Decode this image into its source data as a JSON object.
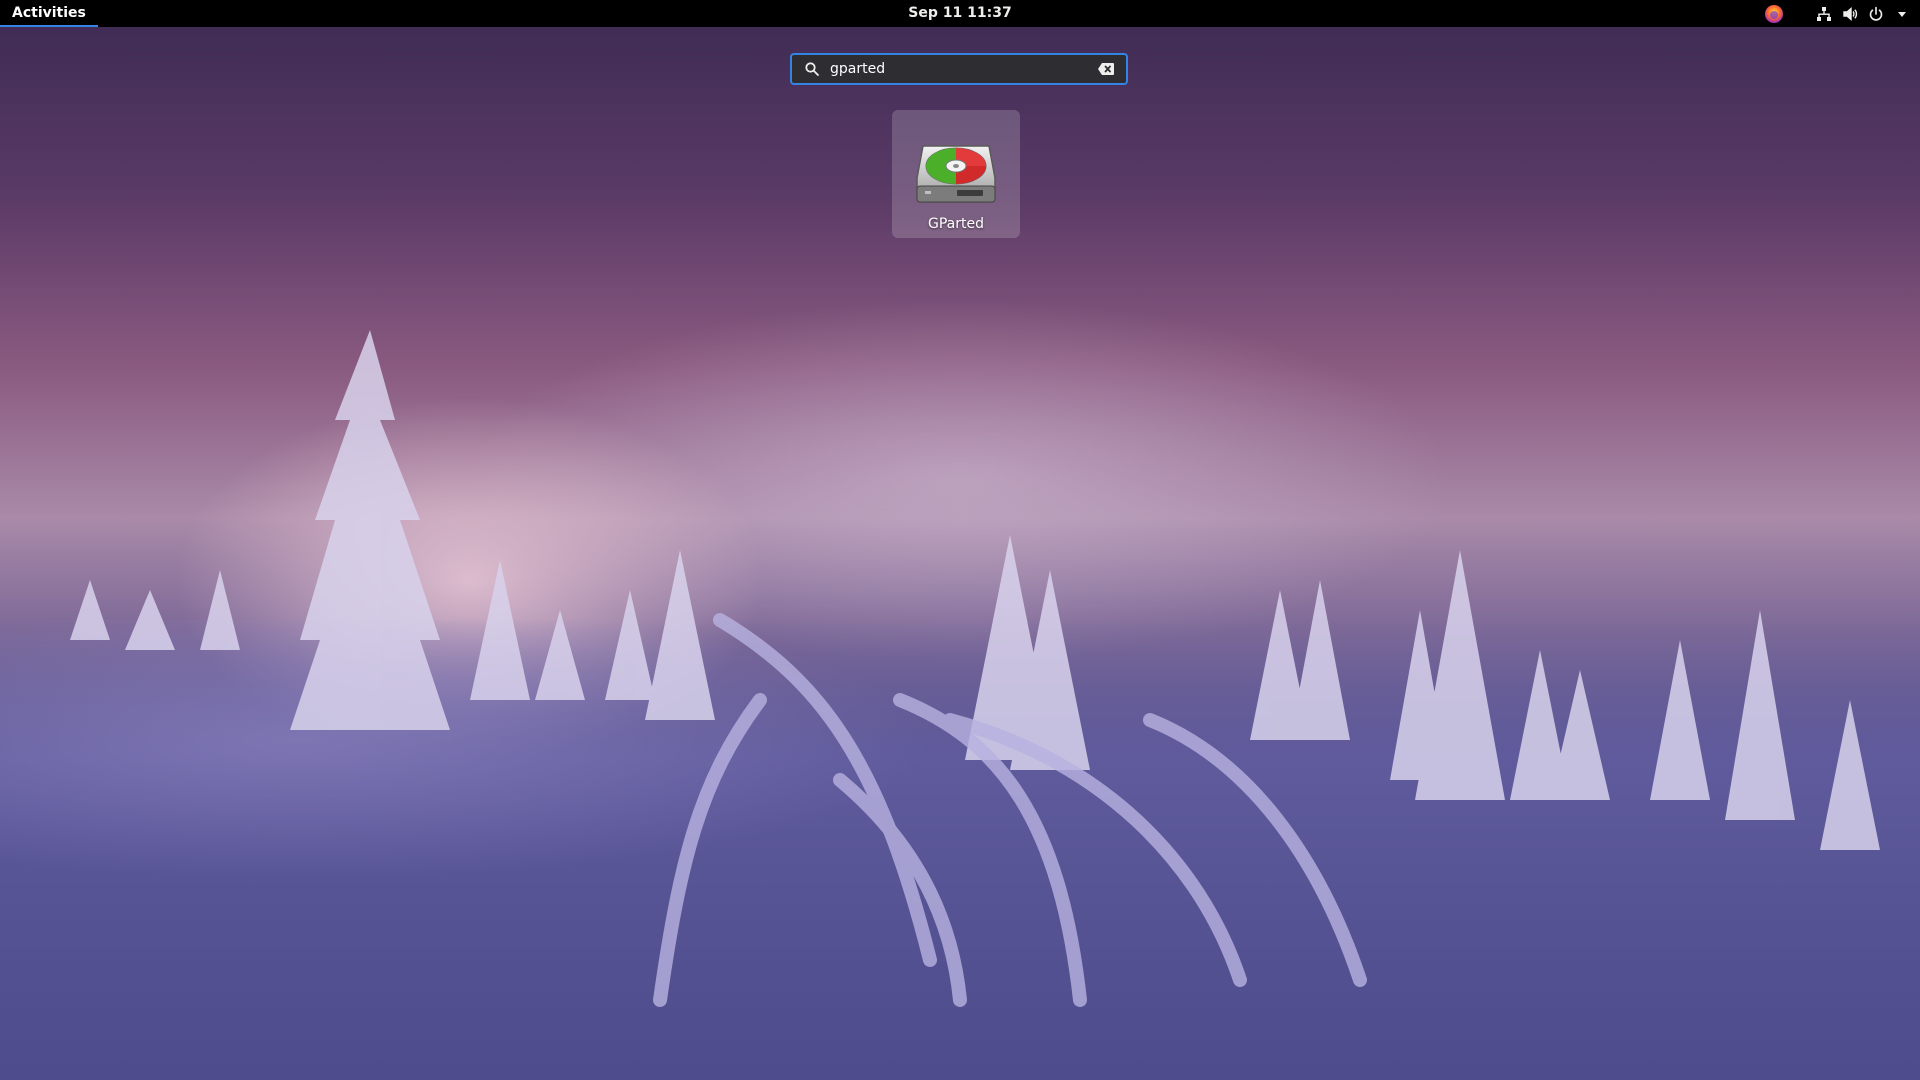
{
  "topbar": {
    "activities_label": "Activities",
    "clock": "Sep 11  11:37",
    "tray": {
      "firefox_icon": "firefox-icon",
      "network_icon": "network-wired-icon",
      "volume_icon": "speaker-icon",
      "power_icon": "power-icon",
      "menu_icon": "chevron-down-icon"
    }
  },
  "search": {
    "value": "gparted",
    "search_icon": "search-icon",
    "clear_icon": "clear-icon",
    "accent": "#3584e4"
  },
  "results": [
    {
      "name": "GParted",
      "icon": "gparted-disk-icon"
    }
  ],
  "colors": {
    "panel_bg": "#000000",
    "accent": "#3584e4",
    "tile_bg": "#ffffff"
  }
}
